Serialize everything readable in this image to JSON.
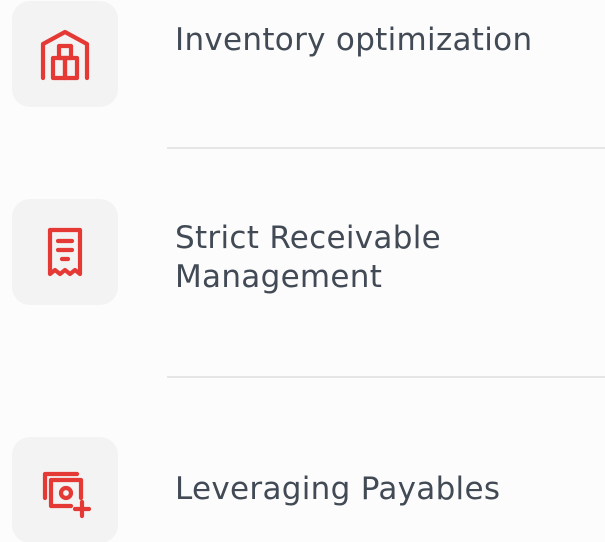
{
  "items": [
    {
      "title": "Inventory optimization",
      "icon": "warehouse-icon"
    },
    {
      "title_line1": "Strict Receivable",
      "title_line2": "Management",
      "icon": "receipt-icon"
    },
    {
      "title": "Leveraging Payables",
      "icon": "cash-add-icon"
    }
  ],
  "colors": {
    "accent": "#e53935",
    "text": "#414a55",
    "tile": "#f3f3f3",
    "divider": "#e6e6e6",
    "background": "#fcfcfc"
  }
}
